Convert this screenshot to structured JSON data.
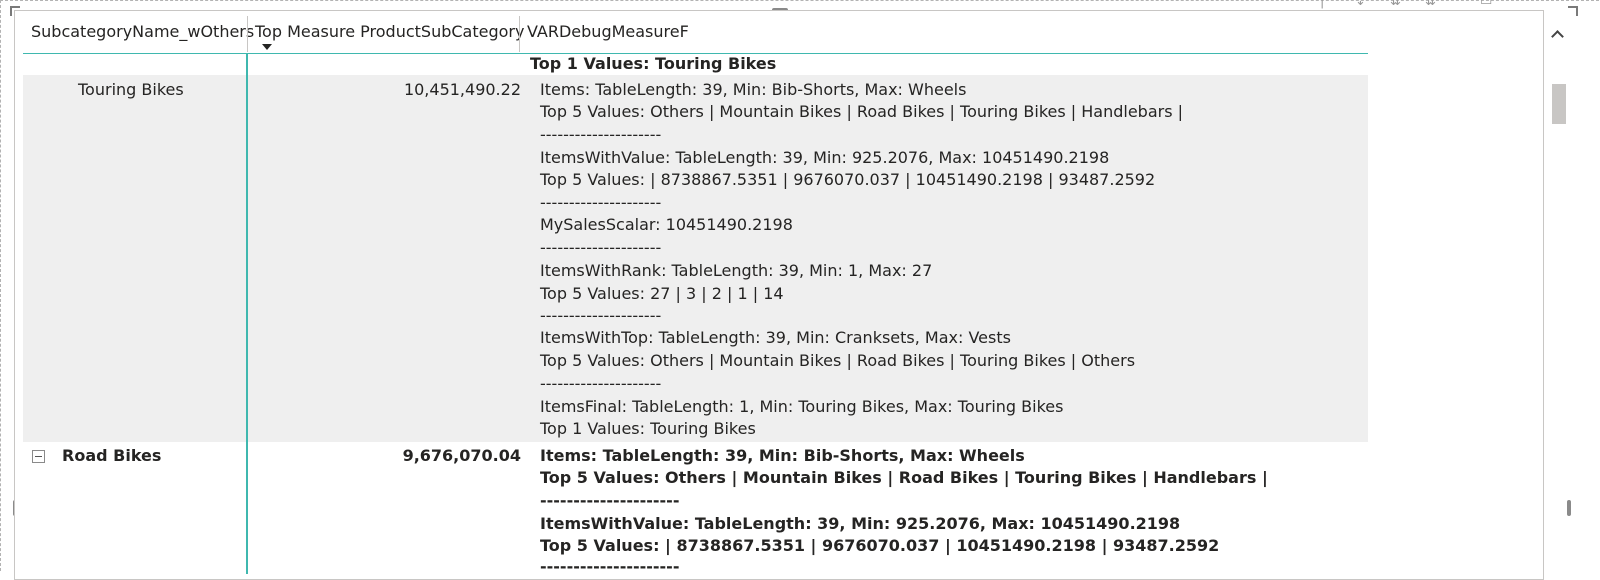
{
  "table": {
    "headers": [
      "SubcategoryName_wOthers",
      "Top Measure ProductSubCategory",
      "VARDebugMeasureF"
    ],
    "top_partial_line": "Top 1 Values: Touring Bikes",
    "rows": [
      {
        "name": "Touring Bikes",
        "value": "10,451,490.22",
        "debug_lines": [
          "Items: TableLength: 39, Min: Bib-Shorts, Max: Wheels",
          "Top 5 Values: Others | Mountain Bikes | Road Bikes | Touring Bikes | Handlebars |",
          "---------------------",
          "ItemsWithValue: TableLength: 39, Min: 925.2076, Max: 10451490.2198",
          "Top 5 Values: | 8738867.5351 | 9676070.037 | 10451490.2198 | 93487.2592",
          "---------------------",
          "MySalesScalar: 10451490.2198",
          "---------------------",
          "ItemsWithRank: TableLength: 39, Min: 1, Max: 27",
          "Top 5 Values: 27 | 3 | 2 | 1 | 14",
          "---------------------",
          "ItemsWithTop: TableLength: 39, Min: Cranksets, Max: Vests",
          "Top 5 Values: Others | Mountain Bikes | Road Bikes | Touring Bikes | Others",
          "---------------------",
          "ItemsFinal: TableLength: 1, Min: Touring Bikes, Max: Touring Bikes",
          "Top 1 Values: Touring Bikes"
        ]
      },
      {
        "name": "Road Bikes",
        "value": "9,676,070.04",
        "debug_lines": [
          "Items: TableLength: 39, Min: Bib-Shorts, Max: Wheels",
          "Top 5 Values: Others | Mountain Bikes | Road Bikes | Touring Bikes | Handlebars |",
          "---------------------",
          "ItemsWithValue: TableLength: 39, Min: 925.2076, Max: 10451490.2198",
          "Top 5 Values: | 8738867.5351 | 9676070.037 | 10451490.2198 | 93487.2592",
          "---------------------"
        ]
      }
    ]
  },
  "colors": {
    "accent_teal": "#3fb8af",
    "row_shade": "#efefef",
    "text": "#252423"
  },
  "icons": [
    "collapse-icon",
    "scroll-up-icon",
    "sort-descending-icon"
  ]
}
